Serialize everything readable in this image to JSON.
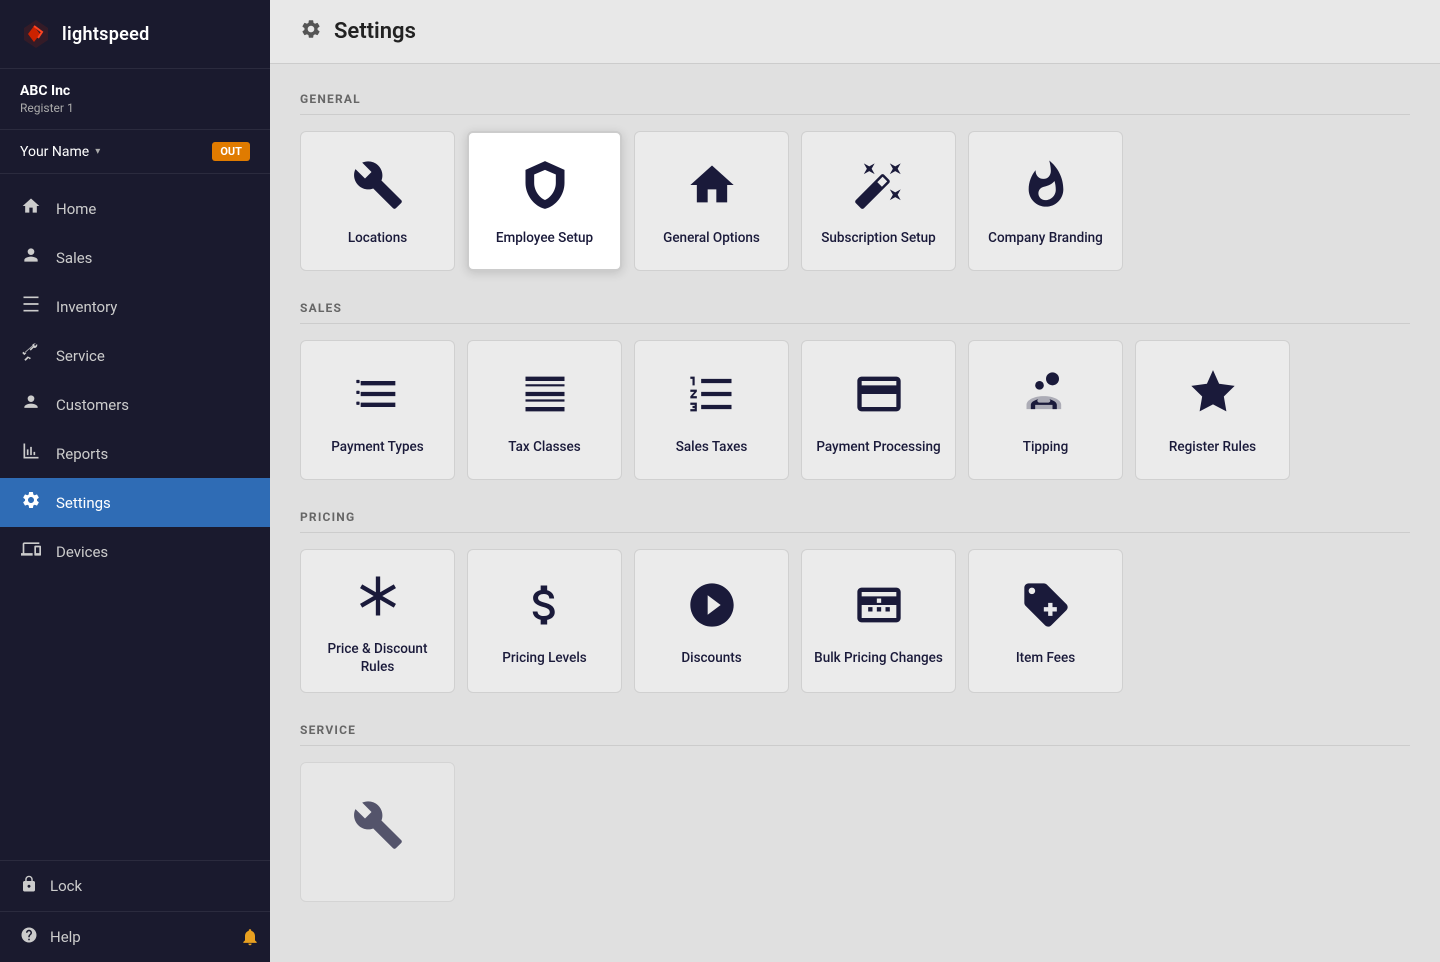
{
  "sidebar": {
    "logo_text": "lightspeed",
    "store": {
      "name": "ABC Inc",
      "register": "Register 1"
    },
    "user": {
      "name": "Your Name",
      "status": "OUT"
    },
    "nav_items": [
      {
        "id": "home",
        "label": "Home",
        "icon": "home"
      },
      {
        "id": "sales",
        "label": "Sales",
        "icon": "sales"
      },
      {
        "id": "inventory",
        "label": "Inventory",
        "icon": "inventory"
      },
      {
        "id": "service",
        "label": "Service",
        "icon": "service"
      },
      {
        "id": "customers",
        "label": "Customers",
        "icon": "customers"
      },
      {
        "id": "reports",
        "label": "Reports",
        "icon": "reports"
      },
      {
        "id": "settings",
        "label": "Settings",
        "icon": "settings",
        "active": true
      },
      {
        "id": "devices",
        "label": "Devices",
        "icon": "devices"
      }
    ],
    "lock_label": "Lock",
    "help_label": "Help"
  },
  "header": {
    "title": "Settings"
  },
  "sections": [
    {
      "id": "general",
      "title": "GENERAL",
      "cards": [
        {
          "id": "locations",
          "label": "Locations",
          "icon": "wrench"
        },
        {
          "id": "employee-setup",
          "label": "Employee Setup",
          "icon": "shield",
          "active": true
        },
        {
          "id": "general-options",
          "label": "General Options",
          "icon": "house"
        },
        {
          "id": "subscription-setup",
          "label": "Subscription Setup",
          "icon": "wand"
        },
        {
          "id": "company-branding",
          "label": "Company Branding",
          "icon": "flame"
        }
      ]
    },
    {
      "id": "sales",
      "title": "SALES",
      "cards": [
        {
          "id": "payment-types",
          "label": "Payment Types",
          "icon": "list-check"
        },
        {
          "id": "tax-classes",
          "label": "Tax Classes",
          "icon": "list-lines"
        },
        {
          "id": "sales-taxes",
          "label": "Sales Taxes",
          "icon": "numbered-list"
        },
        {
          "id": "payment-processing",
          "label": "Payment Processing",
          "icon": "credit-card"
        },
        {
          "id": "tipping",
          "label": "Tipping",
          "icon": "tipping"
        },
        {
          "id": "register-rules",
          "label": "Register Rules",
          "icon": "star-badge"
        }
      ]
    },
    {
      "id": "pricing",
      "title": "PRICING",
      "cards": [
        {
          "id": "price-discount-rules",
          "label": "Price & Discount Rules",
          "icon": "asterisk"
        },
        {
          "id": "pricing-levels",
          "label": "Pricing Levels",
          "icon": "dollar"
        },
        {
          "id": "discounts",
          "label": "Discounts",
          "icon": "chevron-circle"
        },
        {
          "id": "bulk-pricing-changes",
          "label": "Bulk Pricing Changes",
          "icon": "money-bill"
        },
        {
          "id": "item-fees",
          "label": "Item Fees",
          "icon": "tag-plus"
        }
      ]
    },
    {
      "id": "service",
      "title": "SERVICE",
      "cards": []
    }
  ]
}
